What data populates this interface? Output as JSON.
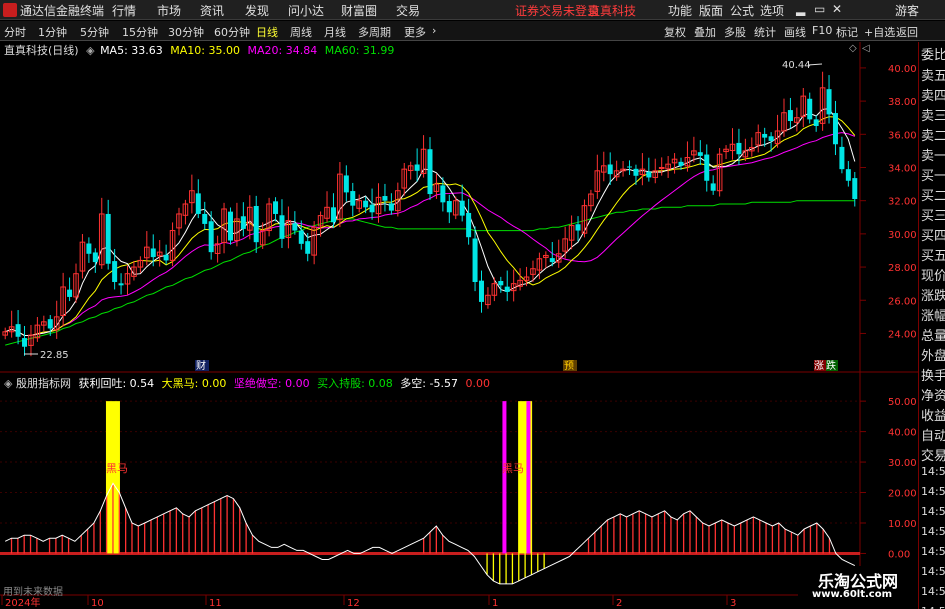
{
  "menu": {
    "app_title": "通达信金融终端",
    "items": [
      "行情",
      "市场",
      "资讯",
      "发现",
      "问小达",
      "财富圈",
      "交易"
    ],
    "warning": "证券交易未登录",
    "stock_name": "直真科技",
    "right_items": [
      "功能",
      "版面",
      "公式",
      "选项"
    ],
    "guest": "游客",
    "window_controls": [
      "▂",
      "▭",
      "✕"
    ]
  },
  "toolbar": {
    "periods": [
      "分时",
      "1分钟",
      "5分钟",
      "15分钟",
      "30分钟",
      "60分钟",
      "日线",
      "周线",
      "月线",
      "多周期",
      "更多"
    ],
    "active_period": "日线",
    "right_buttons": [
      "复权",
      "叠加",
      "多股",
      "统计",
      "画线",
      "F10",
      "标记",
      "+自选",
      "返回"
    ]
  },
  "main_info": {
    "title": "直真科技(日线)",
    "ma5_label": "MA5: 33.63",
    "ma10_label": "MA10: 35.00",
    "ma20_label": "MA20: 34.84",
    "ma60_label": "MA60: 31.99"
  },
  "indicator_info": {
    "name": "殷朋指标网",
    "v1": "获利回吐: 0.54",
    "v2": "大黑马: 0.00",
    "v3": "坚绝做空: 0.00",
    "v4": "买入持股: 0.08",
    "v5": "多空: -5.57",
    "v6": "0.00"
  },
  "markers": {
    "cai": "财",
    "yu": "预",
    "zhang": "涨",
    "die": "跌",
    "heima1": "黑马",
    "heima2": "黑马",
    "low_label": "22.85",
    "high_label": "40.44"
  },
  "right_panel": [
    "委比",
    "卖五",
    "卖四",
    "卖三",
    "卖二",
    "卖一",
    "买一",
    "买二",
    "买三",
    "买四",
    "买五",
    "现价",
    "涨跌",
    "涨幅",
    "总量",
    "外盘",
    "换手",
    "净资",
    "收益",
    "自动",
    "交易",
    "14:56",
    "14:56",
    "14:56",
    "14:56",
    "14:56",
    "14:56",
    "14:56",
    "14:56",
    "14:56"
  ],
  "bottom": {
    "note": "用到未来数据"
  },
  "watermark": {
    "line1": "乐淘公式网",
    "line2": "www.60lt.com"
  },
  "colors": {
    "up": "#ff3232",
    "down": "#00e5e5",
    "ma5": "#ffffff",
    "ma10": "#ffff00",
    "ma20": "#ff00ff",
    "ma60": "#00e000",
    "accent": "#c81e1e",
    "yellow": "#ffff00",
    "magenta": "#ff00ff"
  },
  "chart_data": [
    {
      "type": "candlestick",
      "title": "直真科技(日线)",
      "y_ticks": [
        24.0,
        26.0,
        28.0,
        30.0,
        32.0,
        34.0,
        36.0,
        38.0,
        40.0
      ],
      "ylim": [
        22.4,
        41.2
      ],
      "x_ticks": [
        "2024年",
        "10",
        "11",
        "12",
        "1",
        "2",
        "3"
      ],
      "last": {
        "ma5": 33.63,
        "ma10": 35.0,
        "ma20": 34.84,
        "ma60": 31.99
      },
      "low": 22.85,
      "high": 40.44,
      "closes": [
        24.1,
        24.4,
        23.8,
        23.2,
        23.9,
        24.5,
        24.7,
        24.3,
        25.0,
        26.8,
        26.2,
        27.6,
        29.5,
        28.8,
        28.3,
        31.2,
        28.2,
        27.1,
        26.9,
        27.6,
        28.0,
        28.4,
        29.2,
        28.6,
        28.9,
        28.4,
        30.2,
        31.2,
        31.8,
        32.6,
        31.2,
        30.6,
        28.9,
        29.4,
        31.5,
        29.6,
        30.9,
        30.3,
        31.6,
        29.5,
        30.2,
        31.8,
        31.2,
        29.7,
        30.8,
        30.2,
        29.4,
        28.8,
        30.4,
        31.1,
        31.6,
        30.7,
        33.6,
        32.5,
        31.7,
        32.0,
        31.6,
        31.3,
        32.2,
        32.0,
        31.4,
        32.6,
        33.9,
        34.1,
        33.8,
        35.1,
        32.4,
        33.0,
        31.9,
        31.3,
        32.0,
        31.1,
        29.8,
        27.1,
        25.9,
        26.3,
        27.0,
        26.9,
        26.5,
        27.0,
        27.2,
        27.4,
        27.9,
        28.5,
        28.7,
        28.3,
        28.8,
        29.7,
        30.5,
        30.2,
        31.7,
        32.4,
        33.8,
        34.1,
        33.6,
        33.8,
        33.9,
        34.0,
        33.5,
        33.9,
        33.4,
        33.8,
        34.0,
        34.2,
        34.5,
        34.1,
        34.6,
        35.0,
        34.7,
        33.2,
        32.6,
        34.8,
        35.1,
        35.4,
        34.8,
        35.0,
        35.2,
        36.1,
        35.8,
        35.6,
        36.2,
        37.3,
        36.8,
        37.0,
        38.3,
        36.9,
        36.5,
        38.8,
        37.2,
        35.4,
        33.9,
        33.2,
        32.1
      ],
      "ma60": [
        23.3,
        23.4,
        23.5,
        23.6,
        23.7,
        23.8,
        23.9,
        24.0,
        24.1,
        24.3,
        24.4,
        24.6,
        24.7,
        24.9,
        25.0,
        25.2,
        25.3,
        25.5,
        25.6,
        25.8,
        25.9,
        26.1,
        26.3,
        26.4,
        26.6,
        26.8,
        26.9,
        27.1,
        27.3,
        27.4,
        27.6,
        27.8,
        27.9,
        28.1,
        28.3,
        28.4,
        28.6,
        28.8,
        28.9,
        29.1,
        29.3,
        29.4,
        29.6,
        29.8,
        29.9,
        30.1,
        30.2,
        30.4,
        30.5,
        30.6,
        30.7,
        30.8,
        30.9,
        30.9,
        30.9,
        30.8,
        30.7,
        30.6,
        30.5,
        30.4,
        30.4,
        30.3,
        30.3,
        30.3,
        30.3,
        30.3,
        30.3,
        30.3,
        30.3,
        30.3,
        30.3,
        30.3,
        30.3,
        30.2,
        30.2,
        30.2,
        30.2,
        30.2,
        30.2,
        30.2,
        30.2,
        30.2,
        30.2,
        30.3,
        30.3,
        30.4,
        30.4,
        30.5,
        30.6,
        30.7,
        30.8,
        30.9,
        31.0,
        31.1,
        31.2,
        31.3,
        31.3,
        31.4,
        31.4,
        31.5,
        31.5,
        31.5,
        31.6,
        31.6,
        31.6,
        31.6,
        31.7,
        31.7,
        31.7,
        31.7,
        31.7,
        31.8,
        31.8,
        31.8,
        31.8,
        31.8,
        31.9,
        31.9,
        31.9,
        31.9,
        31.9,
        31.9,
        31.9,
        32.0,
        32.0,
        32.0,
        32.0,
        32.0,
        32.0,
        32.0,
        32.0,
        32.0,
        32.0
      ]
    },
    {
      "type": "bar",
      "title": "殷朋指标网",
      "y_ticks": [
        0.0,
        10.0,
        20.0,
        30.0,
        40.0,
        50.0
      ],
      "ylim": [
        -12,
        53
      ],
      "line": [
        4,
        5,
        5,
        6,
        6,
        5,
        4,
        5,
        5,
        6,
        5,
        4,
        6,
        8,
        10,
        14,
        19,
        23,
        20,
        15,
        10,
        9,
        10,
        11,
        12,
        13,
        14,
        15,
        13,
        12,
        14,
        15,
        16,
        17,
        18,
        19,
        18,
        15,
        10,
        6,
        4,
        3,
        2,
        2,
        3,
        2,
        1,
        1,
        0,
        -1,
        -2,
        -2,
        -1,
        0,
        1,
        0,
        0,
        1,
        2,
        2,
        1,
        0,
        1,
        2,
        3,
        4,
        5,
        7,
        9,
        6,
        4,
        3,
        2,
        1,
        -1,
        -4,
        -7,
        -9,
        -10,
        -10,
        -10,
        -9,
        -8,
        -7,
        -6,
        -5,
        -4,
        -3,
        -2,
        -1,
        1,
        3,
        5,
        7,
        9,
        11,
        12,
        13,
        12,
        13,
        14,
        13,
        12,
        13,
        14,
        12,
        11,
        13,
        14,
        12,
        10,
        9,
        10,
        11,
        10,
        9,
        10,
        11,
        12,
        11,
        10,
        9,
        10,
        8,
        7,
        6,
        8,
        9,
        10,
        8,
        5,
        0,
        -2,
        -3,
        -4
      ],
      "yellow_bars": [
        17,
        82
      ],
      "magenta_bars": [
        80
      ]
    }
  ]
}
